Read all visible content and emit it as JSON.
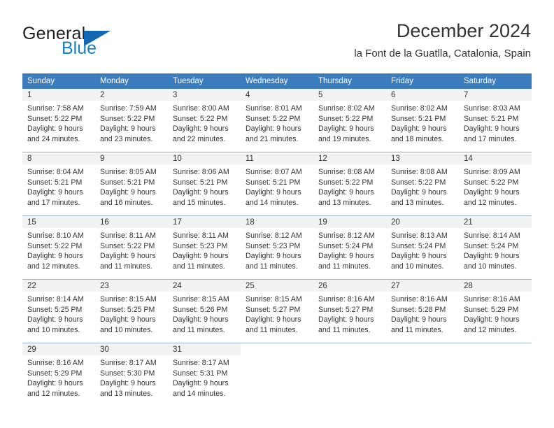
{
  "brand": {
    "name_top": "General",
    "name_bottom": "Blue",
    "triangle_color": "#1268b3",
    "blue_text_color": "#1a7fc1",
    "dark_text_color": "#231f20"
  },
  "header": {
    "title": "December 2024",
    "subtitle": "la Font de la Guatlla, Catalonia, Spain",
    "accent_color": "#3b7cbf",
    "daynum_bg": "#f2f2f2"
  },
  "weekday_headers": [
    "Sunday",
    "Monday",
    "Tuesday",
    "Wednesday",
    "Thursday",
    "Friday",
    "Saturday"
  ],
  "weeks": [
    [
      {
        "day": "1",
        "sunrise": "Sunrise: 7:58 AM",
        "sunset": "Sunset: 5:22 PM",
        "daylight_line1": "Daylight: 9 hours",
        "daylight_line2": "and 24 minutes."
      },
      {
        "day": "2",
        "sunrise": "Sunrise: 7:59 AM",
        "sunset": "Sunset: 5:22 PM",
        "daylight_line1": "Daylight: 9 hours",
        "daylight_line2": "and 23 minutes."
      },
      {
        "day": "3",
        "sunrise": "Sunrise: 8:00 AM",
        "sunset": "Sunset: 5:22 PM",
        "daylight_line1": "Daylight: 9 hours",
        "daylight_line2": "and 22 minutes."
      },
      {
        "day": "4",
        "sunrise": "Sunrise: 8:01 AM",
        "sunset": "Sunset: 5:22 PM",
        "daylight_line1": "Daylight: 9 hours",
        "daylight_line2": "and 21 minutes."
      },
      {
        "day": "5",
        "sunrise": "Sunrise: 8:02 AM",
        "sunset": "Sunset: 5:22 PM",
        "daylight_line1": "Daylight: 9 hours",
        "daylight_line2": "and 19 minutes."
      },
      {
        "day": "6",
        "sunrise": "Sunrise: 8:02 AM",
        "sunset": "Sunset: 5:21 PM",
        "daylight_line1": "Daylight: 9 hours",
        "daylight_line2": "and 18 minutes."
      },
      {
        "day": "7",
        "sunrise": "Sunrise: 8:03 AM",
        "sunset": "Sunset: 5:21 PM",
        "daylight_line1": "Daylight: 9 hours",
        "daylight_line2": "and 17 minutes."
      }
    ],
    [
      {
        "day": "8",
        "sunrise": "Sunrise: 8:04 AM",
        "sunset": "Sunset: 5:21 PM",
        "daylight_line1": "Daylight: 9 hours",
        "daylight_line2": "and 17 minutes."
      },
      {
        "day": "9",
        "sunrise": "Sunrise: 8:05 AM",
        "sunset": "Sunset: 5:21 PM",
        "daylight_line1": "Daylight: 9 hours",
        "daylight_line2": "and 16 minutes."
      },
      {
        "day": "10",
        "sunrise": "Sunrise: 8:06 AM",
        "sunset": "Sunset: 5:21 PM",
        "daylight_line1": "Daylight: 9 hours",
        "daylight_line2": "and 15 minutes."
      },
      {
        "day": "11",
        "sunrise": "Sunrise: 8:07 AM",
        "sunset": "Sunset: 5:21 PM",
        "daylight_line1": "Daylight: 9 hours",
        "daylight_line2": "and 14 minutes."
      },
      {
        "day": "12",
        "sunrise": "Sunrise: 8:08 AM",
        "sunset": "Sunset: 5:22 PM",
        "daylight_line1": "Daylight: 9 hours",
        "daylight_line2": "and 13 minutes."
      },
      {
        "day": "13",
        "sunrise": "Sunrise: 8:08 AM",
        "sunset": "Sunset: 5:22 PM",
        "daylight_line1": "Daylight: 9 hours",
        "daylight_line2": "and 13 minutes."
      },
      {
        "day": "14",
        "sunrise": "Sunrise: 8:09 AM",
        "sunset": "Sunset: 5:22 PM",
        "daylight_line1": "Daylight: 9 hours",
        "daylight_line2": "and 12 minutes."
      }
    ],
    [
      {
        "day": "15",
        "sunrise": "Sunrise: 8:10 AM",
        "sunset": "Sunset: 5:22 PM",
        "daylight_line1": "Daylight: 9 hours",
        "daylight_line2": "and 12 minutes."
      },
      {
        "day": "16",
        "sunrise": "Sunrise: 8:11 AM",
        "sunset": "Sunset: 5:22 PM",
        "daylight_line1": "Daylight: 9 hours",
        "daylight_line2": "and 11 minutes."
      },
      {
        "day": "17",
        "sunrise": "Sunrise: 8:11 AM",
        "sunset": "Sunset: 5:23 PM",
        "daylight_line1": "Daylight: 9 hours",
        "daylight_line2": "and 11 minutes."
      },
      {
        "day": "18",
        "sunrise": "Sunrise: 8:12 AM",
        "sunset": "Sunset: 5:23 PM",
        "daylight_line1": "Daylight: 9 hours",
        "daylight_line2": "and 11 minutes."
      },
      {
        "day": "19",
        "sunrise": "Sunrise: 8:12 AM",
        "sunset": "Sunset: 5:24 PM",
        "daylight_line1": "Daylight: 9 hours",
        "daylight_line2": "and 11 minutes."
      },
      {
        "day": "20",
        "sunrise": "Sunrise: 8:13 AM",
        "sunset": "Sunset: 5:24 PM",
        "daylight_line1": "Daylight: 9 hours",
        "daylight_line2": "and 10 minutes."
      },
      {
        "day": "21",
        "sunrise": "Sunrise: 8:14 AM",
        "sunset": "Sunset: 5:24 PM",
        "daylight_line1": "Daylight: 9 hours",
        "daylight_line2": "and 10 minutes."
      }
    ],
    [
      {
        "day": "22",
        "sunrise": "Sunrise: 8:14 AM",
        "sunset": "Sunset: 5:25 PM",
        "daylight_line1": "Daylight: 9 hours",
        "daylight_line2": "and 10 minutes."
      },
      {
        "day": "23",
        "sunrise": "Sunrise: 8:15 AM",
        "sunset": "Sunset: 5:25 PM",
        "daylight_line1": "Daylight: 9 hours",
        "daylight_line2": "and 10 minutes."
      },
      {
        "day": "24",
        "sunrise": "Sunrise: 8:15 AM",
        "sunset": "Sunset: 5:26 PM",
        "daylight_line1": "Daylight: 9 hours",
        "daylight_line2": "and 11 minutes."
      },
      {
        "day": "25",
        "sunrise": "Sunrise: 8:15 AM",
        "sunset": "Sunset: 5:27 PM",
        "daylight_line1": "Daylight: 9 hours",
        "daylight_line2": "and 11 minutes."
      },
      {
        "day": "26",
        "sunrise": "Sunrise: 8:16 AM",
        "sunset": "Sunset: 5:27 PM",
        "daylight_line1": "Daylight: 9 hours",
        "daylight_line2": "and 11 minutes."
      },
      {
        "day": "27",
        "sunrise": "Sunrise: 8:16 AM",
        "sunset": "Sunset: 5:28 PM",
        "daylight_line1": "Daylight: 9 hours",
        "daylight_line2": "and 11 minutes."
      },
      {
        "day": "28",
        "sunrise": "Sunrise: 8:16 AM",
        "sunset": "Sunset: 5:29 PM",
        "daylight_line1": "Daylight: 9 hours",
        "daylight_line2": "and 12 minutes."
      }
    ],
    [
      {
        "day": "29",
        "sunrise": "Sunrise: 8:16 AM",
        "sunset": "Sunset: 5:29 PM",
        "daylight_line1": "Daylight: 9 hours",
        "daylight_line2": "and 12 minutes."
      },
      {
        "day": "30",
        "sunrise": "Sunrise: 8:17 AM",
        "sunset": "Sunset: 5:30 PM",
        "daylight_line1": "Daylight: 9 hours",
        "daylight_line2": "and 13 minutes."
      },
      {
        "day": "31",
        "sunrise": "Sunrise: 8:17 AM",
        "sunset": "Sunset: 5:31 PM",
        "daylight_line1": "Daylight: 9 hours",
        "daylight_line2": "and 14 minutes."
      },
      {
        "day": "",
        "sunrise": "",
        "sunset": "",
        "daylight_line1": "",
        "daylight_line2": ""
      },
      {
        "day": "",
        "sunrise": "",
        "sunset": "",
        "daylight_line1": "",
        "daylight_line2": ""
      },
      {
        "day": "",
        "sunrise": "",
        "sunset": "",
        "daylight_line1": "",
        "daylight_line2": ""
      },
      {
        "day": "",
        "sunrise": "",
        "sunset": "",
        "daylight_line1": "",
        "daylight_line2": ""
      }
    ]
  ]
}
